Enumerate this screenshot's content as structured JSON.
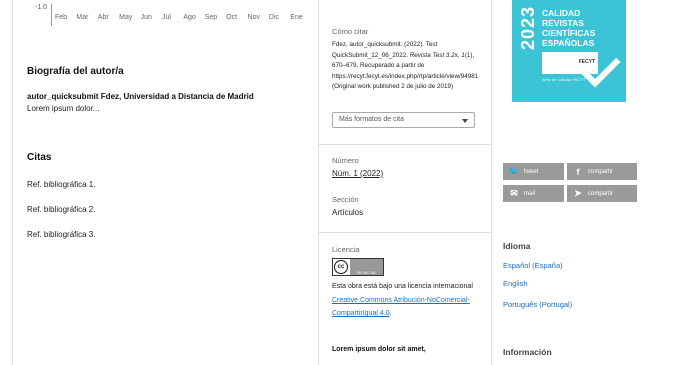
{
  "axis": {
    "y_label": "-1.0",
    "months": [
      "Feb",
      "Mar",
      "Abr",
      "May",
      "Jun",
      "Jul",
      "Ago",
      "Sep",
      "Oct",
      "Nov",
      "Dic",
      "Ene"
    ]
  },
  "bio": {
    "title": "Biografía del autor/a",
    "name": "autor_quicksubmit Fdez, Universidad a Distancia de Madrid",
    "text": "Lorem ipsum dolor..."
  },
  "citas": {
    "title": "Citas",
    "refs": [
      "Ref. bibliográfica 1.",
      "Ref. bibliográfica 2.",
      "Ref. bibliográfica 3."
    ]
  },
  "cite": {
    "label": "Cómo citar",
    "part1": "Fdez, autor_quicksubmit. (2022). Test QuickSubmit_12_06_2022. ",
    "journal": "Revista Test 3.2x, 1",
    "part2": "(1), 670–679. Recuperado a partir de https://recyt.fecyt.es/index.php/rtp/article/view/94981 (Original work published 2 de julio de 2019)",
    "more_formats": "Más formatos de cita"
  },
  "issue": {
    "label": "Número",
    "value": "Núm. 1 (2022)"
  },
  "section": {
    "label": "Sección",
    "value": "Artículos"
  },
  "license": {
    "label": "Licencia",
    "cc": "cc",
    "badge_by": "BY NC SA",
    "text_before": "Esta obra está bajo una licencia internacional ",
    "link": "Creative Commons Atribución-NoComercial-CompartirIgual 4.0",
    "text_after": ".",
    "bold_snippet": "Lorem ipsum dolor sit amet,"
  },
  "badge": {
    "year": "2023",
    "line1": "CALIDAD",
    "line2": "REVISTAS",
    "line3": "CIENTÍFICAS",
    "line4": "ESPAÑOLAS",
    "fecyt": "FECYT",
    "sub": "Sello de Calidad FECYT"
  },
  "share": {
    "tweet": "tweet",
    "compartir_fb": "compartir",
    "mail": "mail",
    "compartir_tg": "compartir"
  },
  "idioma": {
    "title": "Idioma",
    "langs": [
      "Español (España)",
      "English",
      "Português (Portugal)"
    ]
  },
  "info": {
    "title": "Información"
  },
  "colors": {
    "link": "#1e6fb8",
    "badge": "#3cc3d6",
    "share": "#9a9a9a"
  }
}
